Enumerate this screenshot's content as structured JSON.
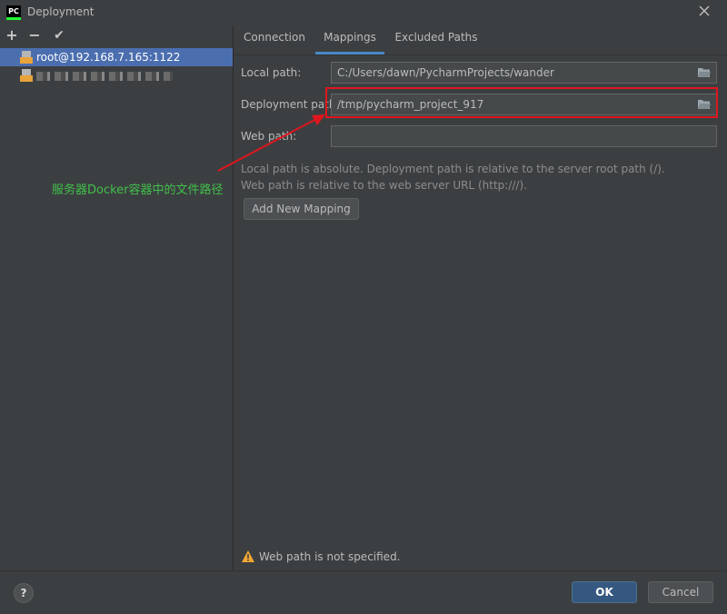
{
  "window": {
    "title": "Deployment",
    "app_icon": "PC"
  },
  "toolbar": {
    "add": "+",
    "remove": "−",
    "apply": "✔"
  },
  "servers": [
    {
      "label": "root@192.168.7.165:1122",
      "selected": true
    },
    {
      "label": "",
      "selected": false
    }
  ],
  "tabs": [
    {
      "label": "Connection",
      "active": false
    },
    {
      "label": "Mappings",
      "active": true
    },
    {
      "label": "Excluded Paths",
      "active": false
    }
  ],
  "mappings": {
    "local_path_label": "Local path:",
    "local_path_value": "C:/Users/dawn/PycharmProjects/wander",
    "deployment_path_label": "Deployment path:",
    "deployment_path_value": "/tmp/pycharm_project_917",
    "web_path_label": "Web path:",
    "web_path_value": "",
    "hint_line1": "Local path is absolute. Deployment path is relative to the server root path (/).",
    "hint_line2": "Web path is relative to the web server URL (http:///).",
    "add_mapping_label": "Add New Mapping"
  },
  "warning": {
    "text": "Web path is not specified."
  },
  "annotation": {
    "text": "服务器Docker容器中的文件路径"
  },
  "footer": {
    "help": "?",
    "ok": "OK",
    "cancel": "Cancel"
  },
  "colors": {
    "accent": "#4b6eaf",
    "highlight": "#e0161d",
    "annotation": "#3fc04a",
    "tab_underline": "#4a88c7"
  }
}
